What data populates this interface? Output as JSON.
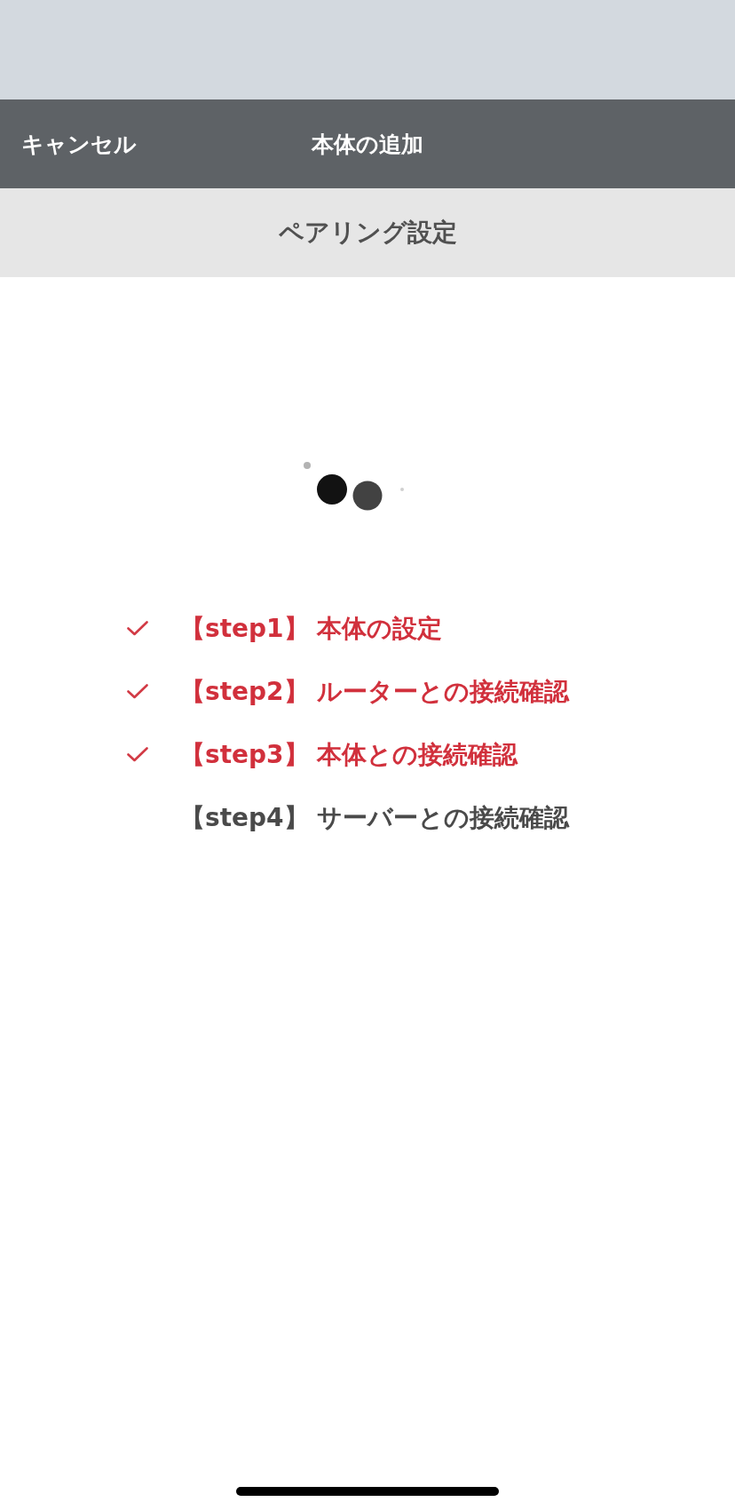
{
  "navigation_bar": {
    "cancel_button": "キャンセル",
    "title": "本体の追加"
  },
  "section_header": {
    "title": "ペアリング設定"
  },
  "steps": [
    {
      "label": "【step1】 本体の設定",
      "done": true
    },
    {
      "label": "【step2】 ルーターとの接続確認",
      "done": true
    },
    {
      "label": "【step3】 本体との接続確認",
      "done": true
    },
    {
      "label": "【step4】 サーバーとの接続確認",
      "done": false
    }
  ]
}
